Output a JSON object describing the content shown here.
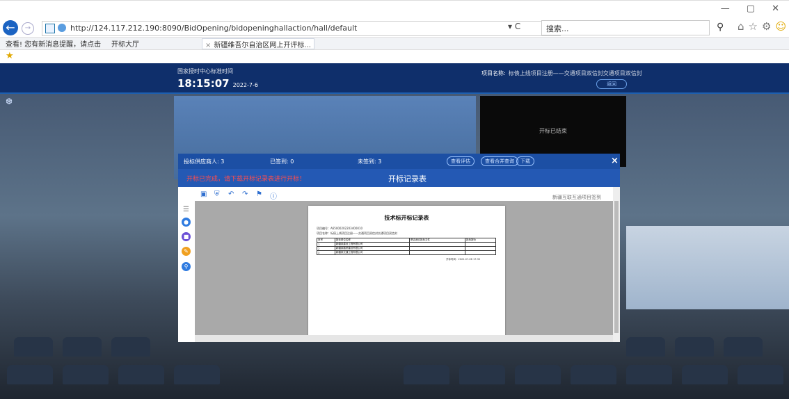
{
  "browser": {
    "window_controls": [
      "—",
      "▢",
      "✕"
    ],
    "url": "http://124.117.212.190:8090/BidOpening/bidopeninghallaction/hall/default",
    "refresh": "▾ C",
    "search_placeholder": "搜索...",
    "tabs": [
      {
        "label": "查看! 您有新消息提醒，请点击"
      },
      {
        "label": "开标大厅"
      },
      {
        "label": "新疆维吾尔自治区网上开评标..."
      }
    ],
    "tab_close": "×"
  },
  "header": {
    "time_label": "国家授时中心标准时间",
    "time": "18:15:07",
    "date": "2022-7-6",
    "project_label": "项目名称:",
    "project_name": "标债上线项目注册——交通项目双信封交通项目双信封",
    "back_button": "返回"
  },
  "hall": {
    "video_status": "开标已结束"
  },
  "modal": {
    "top": {
      "bidders_label": "投标供应商人:",
      "bidders_count": "3",
      "signed_label": "已签到:",
      "signed_count": "0",
      "unsigned_label": "未签到:",
      "unsigned_count": "3",
      "btn_eval": "查看评估",
      "btn_open": "查看合并查询",
      "btn_download": "下载",
      "close": "×"
    },
    "warning": "开标已完成，请下载开标记录表进行开标！",
    "title": "开标记录表",
    "company": "新疆互联互通项目签到",
    "doc": {
      "title": "技术标开标记录表",
      "meta1": "项目编号：A65000202203400010",
      "meta2": "项目名称：标债上线项目注册——交通项目双信封交通项目双信封",
      "table_header": [
        "序号",
        "投标单位名称",
        "是否递交投标文件",
        "投标报价"
      ],
      "rows": [
        [
          "1",
          "新疆某建设工程有限公司",
          "",
          ""
        ],
        [
          "2",
          "新疆某路桥建设有限公司",
          "",
          ""
        ],
        [
          "3",
          "新疆某交通工程有限公司",
          "",
          ""
        ]
      ],
      "signature": "开标时间：2022-07-06 17:30"
    }
  }
}
